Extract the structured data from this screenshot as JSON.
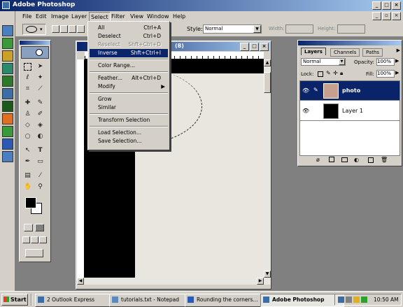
{
  "app": {
    "title": "Adobe Photoshop"
  },
  "menubar": [
    "File",
    "Edit",
    "Image",
    "Layer",
    "Select",
    "Filter",
    "View",
    "Window",
    "Help"
  ],
  "options": {
    "style_label": "Style:",
    "style_value": "Normal",
    "width_label": "Width:",
    "height_label": "Height:"
  },
  "doc": {
    "title_suffix": "(8)"
  },
  "select_menu": [
    {
      "label": "All",
      "shortcut": "Ctrl+A",
      "disabled": false
    },
    {
      "label": "Deselect",
      "shortcut": "Ctrl+D",
      "disabled": false
    },
    {
      "label": "Reselect",
      "shortcut": "Shft+Ctrl+D",
      "disabled": true
    },
    {
      "label": "Inverse",
      "shortcut": "Shft+Ctrl+I",
      "disabled": false,
      "highlighted": true
    },
    {
      "label": "Color Range...",
      "shortcut": "",
      "disabled": false
    },
    {
      "label": "Feather...",
      "shortcut": "Alt+Ctrl+D",
      "disabled": false
    },
    {
      "label": "Modify",
      "shortcut": "",
      "disabled": false,
      "submenu": true
    },
    {
      "label": "Grow",
      "shortcut": "",
      "disabled": false
    },
    {
      "label": "Similar",
      "shortcut": "",
      "disabled": false
    },
    {
      "label": "Transform Selection",
      "shortcut": "",
      "disabled": false
    },
    {
      "label": "Load Selection...",
      "shortcut": "",
      "disabled": false
    },
    {
      "label": "Save Selection...",
      "shortcut": "",
      "disabled": false
    }
  ],
  "layers_panel": {
    "tabs": [
      "Layers",
      "Channels",
      "Paths"
    ],
    "blend_mode": "Normal",
    "opacity_label": "Opacity:",
    "opacity_value": "100%",
    "lock_label": "Lock:",
    "fill_label": "Fill:",
    "fill_value": "100%",
    "layers": [
      {
        "name": "photo",
        "selected": true
      },
      {
        "name": "Layer 1",
        "selected": false
      }
    ]
  },
  "taskbar": {
    "start": "Start",
    "items": [
      "2 Outlook Express",
      "tutorials.txt - Notepad",
      "Rounding the corners...",
      "Adobe Photoshop"
    ],
    "active_item": "Adobe Photoshop",
    "clock": "10:50 AM"
  },
  "colors": {
    "title_blue": "#0a246a",
    "selection": "#0a246a",
    "chrome": "#d4d0c8",
    "desktop": "#808080"
  }
}
